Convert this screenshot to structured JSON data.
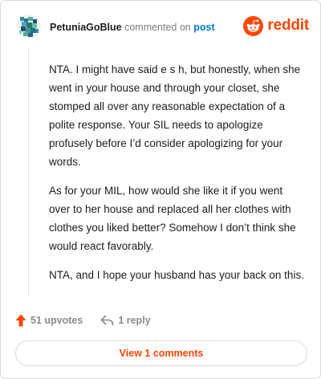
{
  "comment": {
    "author": "PetuniaGoBlue",
    "action_text": "commented on",
    "post_link_label": "post",
    "paragraphs": [
      "NTA. I might have said e s h, but honestly, when she went in your house and through your closet, she stomped all over any reasonable expectation of a polite response. Your SIL needs to apologize profusely before I’d consider apologizing for your words.",
      "As for your MIL, how would she like it if you went over to her house and replaced all her clothes with clothes you liked better? Somehow I don’t think she would react favorably.",
      "NTA, and I hope your husband has your back on this."
    ]
  },
  "brand": {
    "name": "reddit",
    "icon": "reddit-snoo-icon",
    "color": "#ff4500"
  },
  "actions": {
    "upvotes_label": "51 upvotes",
    "upvote_icon": "upvote-arrow-icon",
    "upvote_color": "#ff4500",
    "reply_label": "1 reply",
    "reply_icon": "reply-arrow-icon"
  },
  "footer": {
    "view_comments_label": "View 1 comments"
  }
}
